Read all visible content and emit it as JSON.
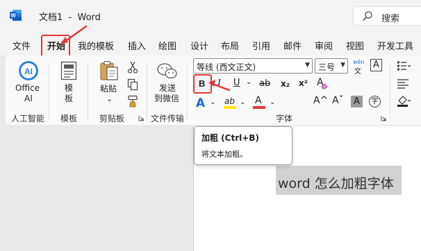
{
  "window": {
    "title": "文档1  -  Word",
    "search_label": "搜索"
  },
  "tabs": [
    {
      "label": "文件"
    },
    {
      "label": "开始"
    },
    {
      "label": "我的模板"
    },
    {
      "label": "插入"
    },
    {
      "label": "绘图"
    },
    {
      "label": "设计"
    },
    {
      "label": "布局"
    },
    {
      "label": "引用"
    },
    {
      "label": "邮件"
    },
    {
      "label": "审阅"
    },
    {
      "label": "视图"
    },
    {
      "label": "开发工具"
    }
  ],
  "ribbon": {
    "office_ai": {
      "label_line1": "Office",
      "label_line2": "AI",
      "icon_text": "AI",
      "group": "人工智能"
    },
    "template": {
      "label_line1": "模",
      "label_line2": "板",
      "group": "模板"
    },
    "clipboard": {
      "paste_label": "粘贴",
      "group": "剪贴板",
      "caret": "⌄"
    },
    "transfer": {
      "label_line1": "发送",
      "label_line2": "到微信",
      "group": "文件传输"
    },
    "font": {
      "font_name": "等线 (西文正文)",
      "font_size": "三号",
      "phonetic_top": "wén",
      "phonetic_bottom": "文",
      "char_border": "A",
      "bold": "B",
      "italic": "I",
      "underline": "U",
      "strike": "ab",
      "subscript": "x₂",
      "superscript": "x²",
      "clear_format": "A",
      "text_effect": "A",
      "highlight": "ab",
      "font_color": "A",
      "grow": "A^",
      "shrink": "Aˇ",
      "shading": "A",
      "enclose": "字",
      "caret": "⌄",
      "group": "字体"
    }
  },
  "tooltip": {
    "title": "加粗 (Ctrl+B)",
    "description": "将文本加粗。"
  },
  "document": {
    "selected_text": "word 怎么加粗字体"
  },
  "colors": {
    "accent": "#185abd",
    "annotation": "#e53935",
    "highlight_yellow": "#ffea00",
    "font_red": "#e53935",
    "word_blue": "#185abd"
  }
}
